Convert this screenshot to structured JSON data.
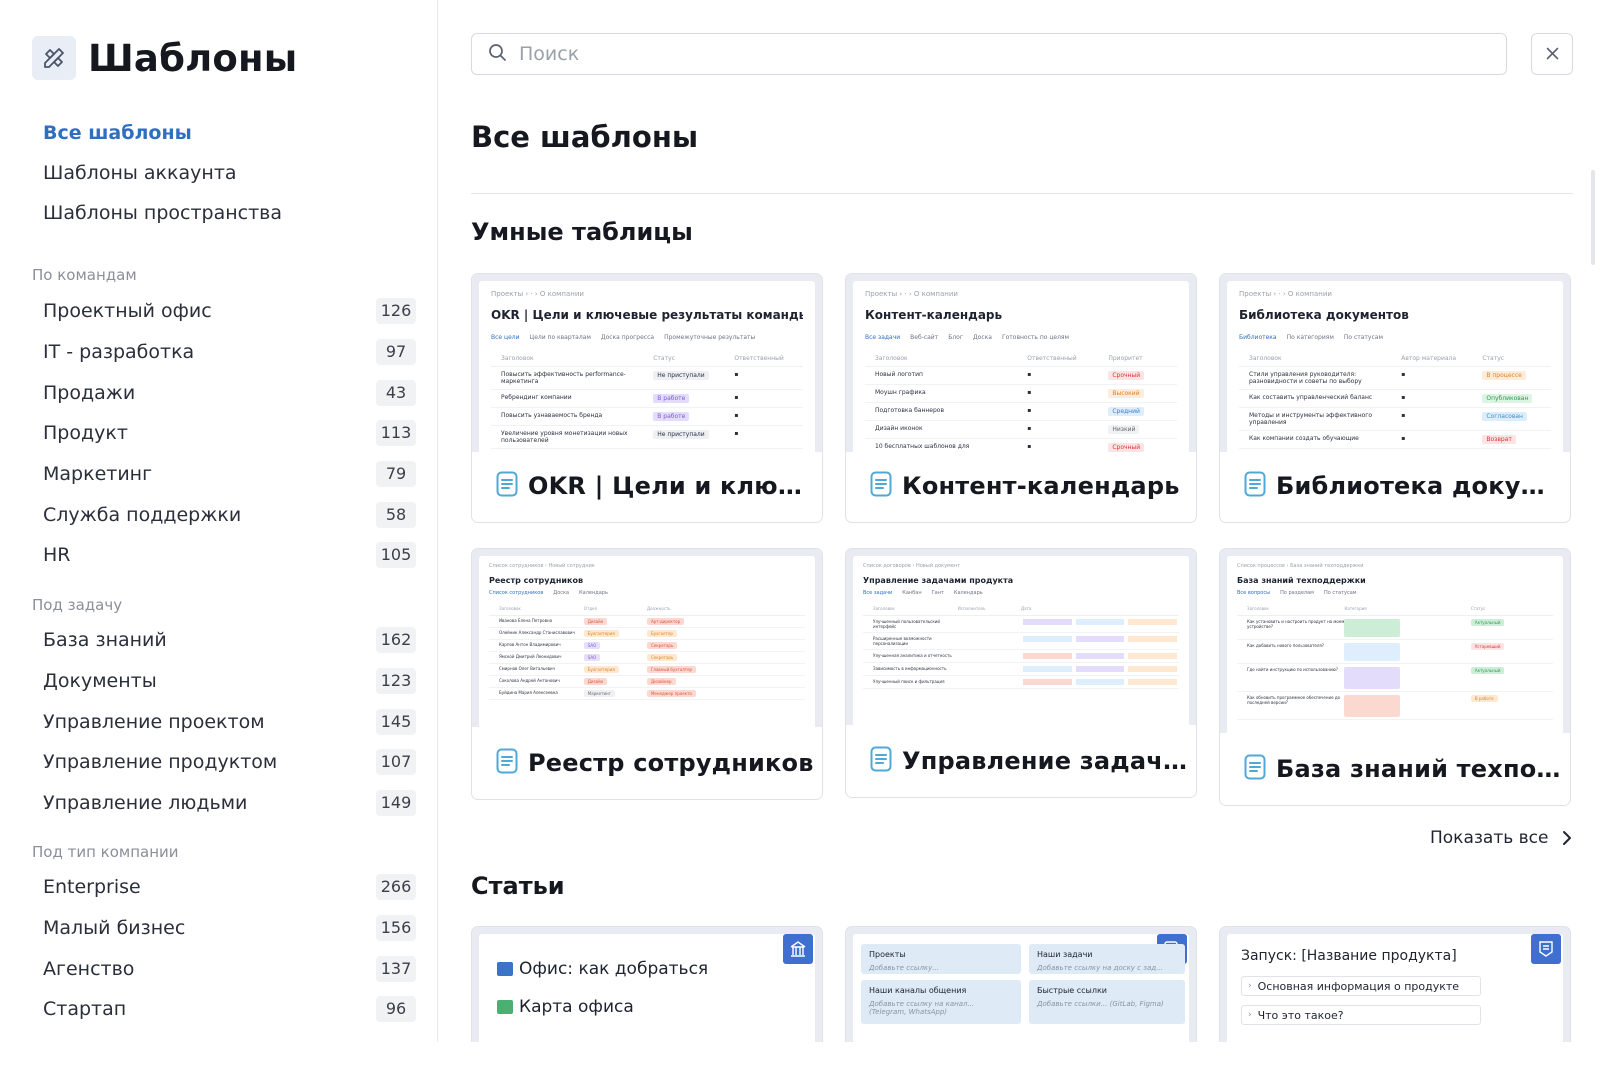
{
  "app": {
    "title": "Шаблоны",
    "logo_icon": "templates-icon"
  },
  "search": {
    "placeholder": "Поиск"
  },
  "nav": {
    "items": [
      {
        "label": "Все шаблоны",
        "active": true
      },
      {
        "label": "Шаблоны аккаунта",
        "active": false
      },
      {
        "label": "Шаблоны пространства",
        "active": false
      }
    ]
  },
  "groups": [
    {
      "title": "По командам",
      "items": [
        {
          "label": "Проектный офис",
          "count": "126"
        },
        {
          "label": "IT - разработка",
          "count": "97"
        },
        {
          "label": "Продажи",
          "count": "43"
        },
        {
          "label": "Продукт",
          "count": "113"
        },
        {
          "label": "Маркетинг",
          "count": "79"
        },
        {
          "label": "Служба поддержки",
          "count": "58"
        },
        {
          "label": "HR",
          "count": "105"
        }
      ]
    },
    {
      "title": "Под задачу",
      "items": [
        {
          "label": "База знаний",
          "count": "162"
        },
        {
          "label": "Документы",
          "count": "123"
        },
        {
          "label": "Управление проектом",
          "count": "145"
        },
        {
          "label": "Управление продуктом",
          "count": "107"
        },
        {
          "label": "Управление людьми",
          "count": "149"
        }
      ]
    },
    {
      "title": "Под тип компании",
      "items": [
        {
          "label": "Enterprise",
          "count": "266"
        },
        {
          "label": "Малый бизнес",
          "count": "156"
        },
        {
          "label": "Агенство",
          "count": "137"
        },
        {
          "label": "Стартап",
          "count": "96"
        }
      ]
    }
  ],
  "main": {
    "title": "Все шаблоны",
    "smart_tables": {
      "title": "Умные таблицы",
      "cards": [
        {
          "name": "OKR | Цели и ключе...",
          "preview": {
            "crumb": "Проекты  ›  ·  ›  О компании",
            "title": "OKR | Цели и ключевые результаты команды",
            "tabs": [
              "Все цели",
              "Цели по кварталам",
              "Доска прогресса",
              "Промежуточные результаты"
            ],
            "headers": [
              "Заголовок",
              "Статус",
              "Ответственный"
            ],
            "rows": [
              [
                "Повысить эффективность performance-маркетинга",
                "Не приступали",
                ""
              ],
              [
                "Ребрендинг компании",
                "В работе",
                ""
              ],
              [
                "Повысить узнаваемость бренда",
                "В работе",
                ""
              ],
              [
                "Увеличение уровня монетизации новых пользователей",
                "Не приступали",
                ""
              ]
            ]
          }
        },
        {
          "name": "Контент-календарь",
          "preview": {
            "crumb": "Проекты  ›  ·  ›  О компании",
            "title": "Контент-календарь",
            "tabs": [
              "Все задачи",
              "Веб-сайт",
              "Блог",
              "Доска",
              "Готовность по целям"
            ],
            "headers": [
              "Заголовок",
              "Ответственный",
              "Приоритет"
            ],
            "rows": [
              [
                "Новый логотип",
                "",
                "Срочный"
              ],
              [
                "Моушн графика",
                "",
                "Высокий"
              ],
              [
                "Подготовка баннеров",
                "",
                "Средний"
              ],
              [
                "Дизайн иконок",
                "",
                "Низкий"
              ],
              [
                "10 бесплатных шаблонов для",
                "",
                "Срочный"
              ]
            ]
          }
        },
        {
          "name": "Библиотека докуме...",
          "preview": {
            "crumb": "Проекты  ›  ·  ›  О компании",
            "title": "Библиотека документов",
            "tabs": [
              "Библиотека",
              "По категориям",
              "По статусам"
            ],
            "headers": [
              "Заголовок",
              "Автор материала",
              "Статус"
            ],
            "rows": [
              [
                "Стили управления руководителя: разновидности и советы по выбору",
                "",
                "В процессе"
              ],
              [
                "Как составить управленческий баланс",
                "",
                "Опубликован"
              ],
              [
                "Методы и инструменты эффективного управления",
                "",
                "Согласован"
              ],
              [
                "Как компании создать обучающие",
                "",
                "Возврат"
              ]
            ]
          }
        },
        {
          "name": "Реестр сотрудников",
          "preview": {
            "crumb": "Список сотрудников  ›  Новый сотрудник",
            "title": "Реестр сотрудников",
            "tabs": [
              "Список сотрудников",
              "Доска",
              "Календарь"
            ],
            "headers": [
              "Заголовок",
              "Отдел",
              "Должность"
            ],
            "rows": [
              [
                "Иванова Елена Петровна",
                "Дизайн",
                "Арт-директор"
              ],
              [
                "Олейник Александр Станиславович",
                "Бухгалтерия",
                "Бухгалтер"
              ],
              [
                "Карпов Антон Владимирович",
                "SAO",
                "Секретарь"
              ],
              [
                "Ямской Дмитрий Леонидович",
                "SAO",
                "Секретарь"
              ],
              [
                "Смирнов Олег Витальевич",
                "Бухгалтерия",
                "Главный бухгалтер"
              ],
              [
                "Соколова Андрей Антонович",
                "Дизайн",
                "Дизайнер"
              ],
              [
                "Буйдина Мария Алексеевна",
                "Маркетинг",
                "Менеджер проекта"
              ]
            ]
          }
        },
        {
          "name": "Управление задача...",
          "preview": {
            "crumb": "Список договоров  ›  Новый документ",
            "title": "Управление задачами продукта",
            "tabs": [
              "Все задачи",
              "Канбан",
              "Гант",
              "Календарь"
            ],
            "headers": [
              "Заголовок",
              "Исполнитель",
              "Дата"
            ],
            "rows": [
              [
                "Улучшенный пользовательский интерфейс",
                "",
                ""
              ],
              [
                "Расширенные возможности персонализации",
                "",
                ""
              ],
              [
                "Улучшенная аналитика и отчетность",
                "",
                ""
              ],
              [
                "Зависимость в информационность",
                "",
                ""
              ],
              [
                "Улучшенный поиск и фильтрация",
                "",
                ""
              ]
            ]
          }
        },
        {
          "name": "База знаний техпод...",
          "preview": {
            "crumb": "Список процессов  ›  База знаний техподдержки",
            "title": "База знаний техподдержки",
            "tabs": [
              "Все вопросы",
              "По разделам",
              "По статусам"
            ],
            "headers": [
              "Заголовок",
              "Категория",
              "Статус"
            ],
            "rows": [
              [
                "Как установить и настроить продукт на моем устройстве?",
                "",
                "Актуальный"
              ],
              [
                "Как добавить нового пользователя?",
                "",
                "Устаревший"
              ],
              [
                "Где найти инструкцию по использованию?",
                "",
                "Актуальный"
              ],
              [
                "Как обновить программное обеспечение до последней версии?",
                "",
                "В работе"
              ]
            ]
          }
        }
      ],
      "show_all": "Показать все"
    },
    "articles": {
      "title": "Статьи",
      "cards": [
        {
          "lines": [
            "Офис: как добраться",
            "Карта офиса"
          ]
        },
        {
          "blocks": [
            {
              "title": "Проекты",
              "sub": "Добавьте ссылку..."
            },
            {
              "title": "Наши задачи",
              "sub": "Добавьте ссылку на доску с зад..."
            },
            {
              "title": "Наши каналы общения",
              "sub": "Добавьте ссылку на канал... (Telegram, WhatsApp)"
            },
            {
              "title": "Быстрые ссылки",
              "sub": "Добавьте ссылки... (GitLab, Figma)"
            }
          ]
        },
        {
          "title": "Запуск: [Название продукта]",
          "rows": [
            "Основная информация о продукте",
            "Что это такое?"
          ]
        }
      ]
    }
  },
  "colors": {
    "accent": "#2f6fc0",
    "badge": "#3f6fcf",
    "preview_bg": "#e8ecf2"
  }
}
